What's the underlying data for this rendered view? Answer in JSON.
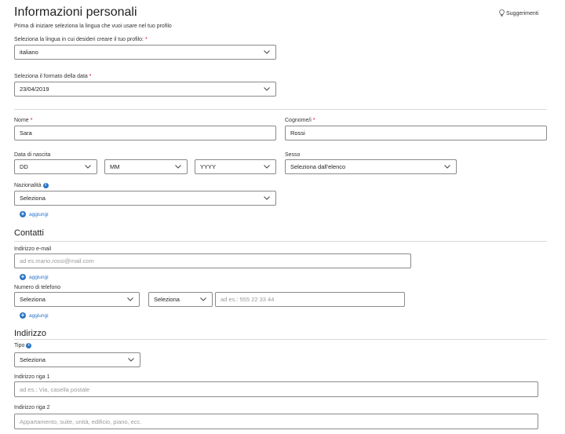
{
  "header": {
    "title": "Informazioni personali",
    "intro": "Prima di iniziare seleziona la lingua che vuoi usare nel tuo profilo",
    "tips": "Suggerimenti"
  },
  "language": {
    "label": "Seleziona la lingua in cui desideri creare il tuo profilo:",
    "value": "italiano"
  },
  "date_format": {
    "label": "Seleziona il formato della data",
    "value": "23/04/2019"
  },
  "required_mark": "*",
  "name": {
    "label": "Nome",
    "value": "Sara"
  },
  "surname": {
    "label": "Cognome/i",
    "value": "Rossi"
  },
  "birth": {
    "label": "Data di nascita",
    "day": "DD",
    "month": "MM",
    "year": "YYYY"
  },
  "gender": {
    "label": "Sesso",
    "value": "Seleziona dall'elenco"
  },
  "nationality": {
    "label": "Nazionalità",
    "value": "Seleziona",
    "info": "i"
  },
  "add_label": "aggiungi",
  "contacts": {
    "title": "Contatti",
    "email_label": "Indirizzo e-mail",
    "email_placeholder": "ad es.mario.rossi@mail.com",
    "phone_label": "Numero di telefono",
    "phone_type": "Seleziona",
    "phone_prefix": "Seleziona",
    "phone_placeholder": "ad es.: 555 22 33 44"
  },
  "address": {
    "title": "Indirizzo",
    "type_label": "Tipo",
    "type_value": "Seleziona",
    "line1_label": "Indirizzo riga 1",
    "line1_placeholder": "ad es.: Via, casella postale",
    "line2_label": "Indirizzo riga 2",
    "line2_placeholder": "Appartamento, suite, unità, edificio, piano, ecc."
  }
}
